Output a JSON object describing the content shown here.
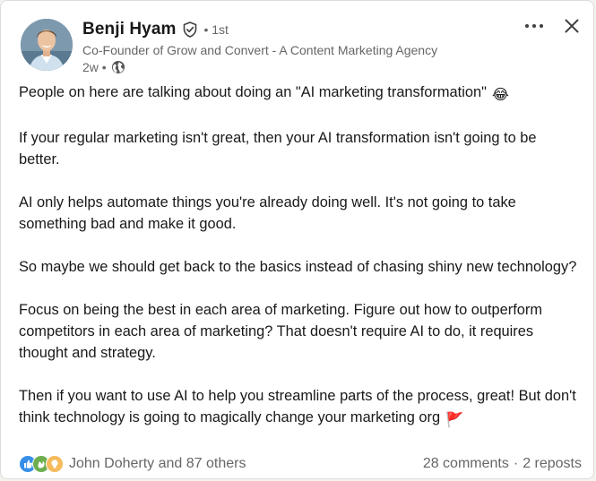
{
  "author": {
    "name": "Benji Hyam",
    "degree": "• 1st",
    "headline": "Co-Founder of Grow and Convert - A Content Marketing Agency",
    "time": "2w •",
    "avatar_icon": "profile-photo",
    "verified_icon": "verified-shield-icon",
    "visibility_icon": "globe-icon"
  },
  "actions": {
    "more_label": "•••",
    "close_icon": "close-icon"
  },
  "post": {
    "paragraphs": [
      "People on here are talking about doing an \"AI marketing transformation\"",
      "If your regular marketing isn't great, then your AI transformation isn't going to be better.",
      "AI only helps automate things you're already doing well. It's not going to take something bad and make it good.",
      "So maybe we should get back to the basics instead of chasing shiny new technology?",
      "Focus on being the best in each area of marketing. Figure out how to outperform competitors in each area of marketing? That doesn't require AI to do, it requires thought and strategy.",
      "Then if you want to use AI to help you streamline parts of the process, great! But don't think technology is going to magically change your marketing org"
    ],
    "emoji_laugh": "😂",
    "emoji_flag": "🚩"
  },
  "social": {
    "reactions_label": "John Doherty and 87 others",
    "reaction_icons": [
      "like-icon",
      "celebrate-icon",
      "insightful-icon"
    ],
    "comments_label": "28 comments",
    "separator": "·",
    "reposts_label": "2 reposts"
  },
  "colors": {
    "like": "#378fe9",
    "celebrate": "#44712e",
    "insightful": "#e7a33e",
    "text_primary": "#191919",
    "text_secondary": "#666666"
  }
}
